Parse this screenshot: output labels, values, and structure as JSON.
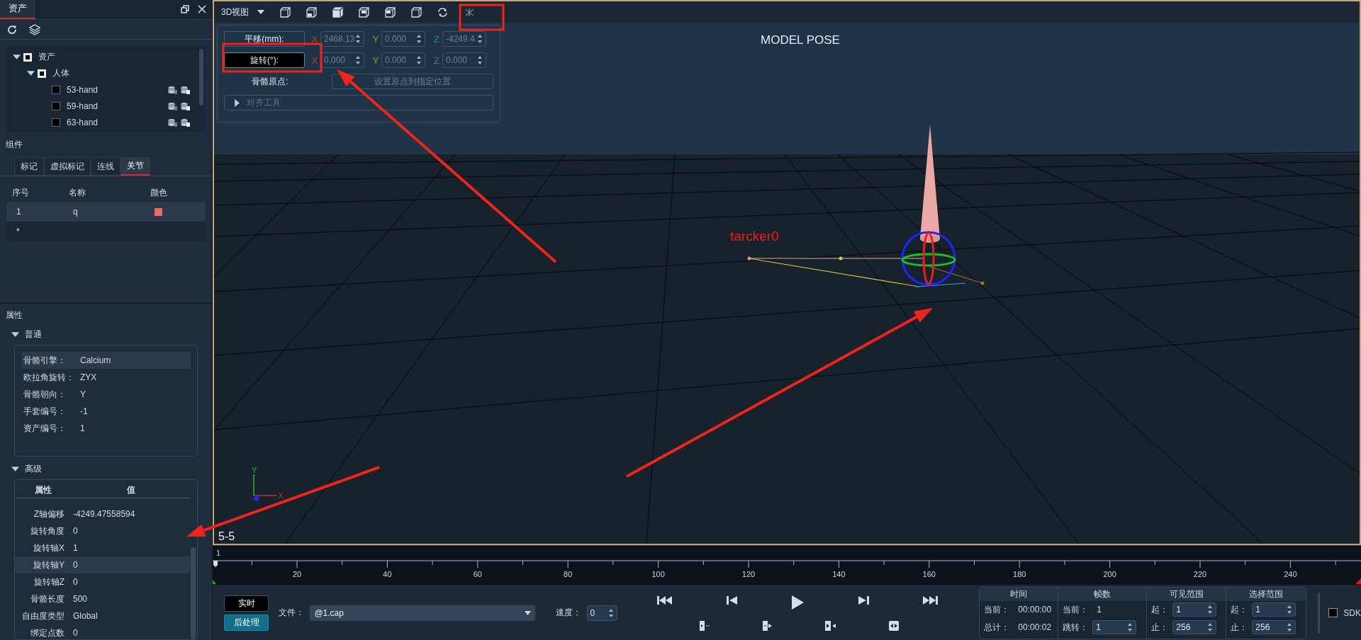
{
  "assets_panel": {
    "tab": {
      "label": "资产",
      "selected": true
    },
    "tree": [
      {
        "label": "资产",
        "expanded": true,
        "partially_checked": true,
        "children": [
          {
            "label": "人体",
            "expanded": true,
            "partially_checked": true,
            "children": [
              {
                "label": "53-hand",
                "partially_checked": false
              },
              {
                "label": "59-hand",
                "partially_checked": false
              },
              {
                "label": "63-hand",
                "partially_checked": false
              }
            ]
          }
        ]
      }
    ],
    "components": {
      "title": "组件",
      "tabs": [
        {
          "label": "标记",
          "selected": false
        },
        {
          "label": "虚拟标记",
          "selected": false
        },
        {
          "label": "连线",
          "selected": false
        },
        {
          "label": "关节",
          "selected": true
        }
      ],
      "columns": [
        "序号",
        "名称",
        "颜色"
      ],
      "rows": [
        {
          "index": "1",
          "name": "q",
          "color": "#e06c6e",
          "selected": true
        }
      ],
      "new_row_marker": "*"
    }
  },
  "properties": {
    "title": "属性",
    "sections": [
      {
        "title": "普通",
        "expanded": true,
        "kind": "form",
        "rows": [
          {
            "label": "骨骼引擎：",
            "value": "Calcium",
            "selected": true
          },
          {
            "label": "欧拉角旋转：",
            "value": "ZYX",
            "selected": false
          },
          {
            "label": "骨骼朝向：",
            "value": "Y",
            "selected": false
          },
          {
            "label": "手套编号：",
            "value": "-1",
            "selected": false
          },
          {
            "label": "资产编号：",
            "value": "1",
            "selected": false
          }
        ]
      },
      {
        "title": "高级",
        "expanded": true,
        "kind": "grid",
        "columns": [
          "属性",
          "值"
        ],
        "rows": [
          {
            "label": "Z轴偏移",
            "value": "-4249.47558594",
            "selected": false
          },
          {
            "label": "旋转角度",
            "value": "0",
            "selected": false
          },
          {
            "label": "旋转轴X",
            "value": "1",
            "selected": false
          },
          {
            "label": "旋转轴Y",
            "value": "0",
            "selected": true
          },
          {
            "label": "旋转轴Z",
            "value": "0",
            "selected": false
          },
          {
            "label": "骨骼长度",
            "value": "500",
            "selected": false
          },
          {
            "label": "自由度类型",
            "value": "Global",
            "selected": false
          },
          {
            "label": "绑定点数",
            "value": "0",
            "selected": false
          }
        ]
      }
    ]
  },
  "view_toolbar": {
    "view_menu": "3D视图"
  },
  "pose_panel": {
    "modes": [
      {
        "label": "平移(mm):",
        "selected": false,
        "values": [
          {
            "axis": "X",
            "color": "#c0392b",
            "value": "2468.13"
          },
          {
            "axis": "Y",
            "color": "#7fa91a",
            "value": "0.000"
          },
          {
            "axis": "Z",
            "color": "#1d7fb8",
            "value": "-4249.4"
          }
        ]
      },
      {
        "label": "旋转(°):",
        "selected": true,
        "values": [
          {
            "axis": "X",
            "color": "#c0392b",
            "value": "0.000"
          },
          {
            "axis": "Y",
            "color": "#7fa91a",
            "value": "0.000"
          },
          {
            "axis": "Z",
            "color": "#1d7fb8",
            "value": "0.000"
          }
        ]
      }
    ],
    "origin_label": "骨骼原点:",
    "origin_button": "设置原点到指定位置",
    "align_tools": {
      "label": "对齐工具",
      "expanded": false
    }
  },
  "viewport": {
    "title": "MODEL POSE",
    "marker_label": "tarcker0",
    "axis_labels": [
      "Y",
      "X"
    ],
    "corner_label": "5-5"
  },
  "timeline": {
    "current_frame": "1",
    "ticks": [
      "20",
      "40",
      "60",
      "80",
      "100",
      "120",
      "140",
      "160",
      "180",
      "200",
      "220",
      "240"
    ]
  },
  "controls": {
    "modes": [
      {
        "label": "实时",
        "selected": false
      },
      {
        "label": "后处理",
        "selected": true
      }
    ],
    "file_label": "文件：",
    "file": "@1.cap",
    "speed_label": "速度：",
    "speed": "0",
    "info": [
      {
        "title": "时间",
        "rows": [
          {
            "label": "当前：",
            "value": "00:00:00",
            "kind": "text"
          },
          {
            "label": "总计：",
            "value": "00:00:02",
            "kind": "text"
          }
        ]
      },
      {
        "title": "帧数",
        "rows": [
          {
            "label": "当前：",
            "value": "1",
            "kind": "text"
          },
          {
            "label": "跳转：",
            "value": "1",
            "kind": "spin"
          }
        ]
      },
      {
        "title": "可见范围",
        "rows": [
          {
            "label": "起：",
            "value": "1",
            "kind": "spin"
          },
          {
            "label": "止：",
            "value": "256",
            "kind": "spin"
          }
        ]
      },
      {
        "title": "选择范围",
        "rows": [
          {
            "label": "起：",
            "value": "1",
            "kind": "spin"
          },
          {
            "label": "止：",
            "value": "256",
            "kind": "spin"
          }
        ]
      }
    ],
    "sdk": {
      "label": "SDK",
      "checked": false
    }
  }
}
